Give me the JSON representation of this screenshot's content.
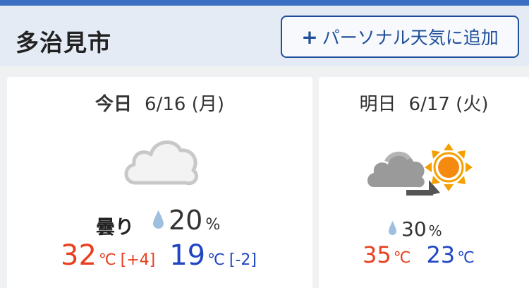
{
  "header": {
    "city": "多治見市",
    "add_button": {
      "plus": "+",
      "label": "パーソナル天気に追加"
    }
  },
  "today": {
    "day_label": "今日",
    "date": "6/16 (月)",
    "condition": "曇り",
    "icon": "cloudy-icon",
    "rain": {
      "value": "20",
      "unit": "%"
    },
    "high": {
      "value": "32",
      "unit": "℃",
      "diff": "[+4]"
    },
    "low": {
      "value": "19",
      "unit": "℃",
      "diff": "[-2]"
    }
  },
  "tomorrow": {
    "day_label": "明日",
    "date": "6/17 (火)",
    "icon": "cloudy-then-sunny-icon",
    "rain": {
      "value": "30",
      "unit": "%"
    },
    "high": {
      "value": "35",
      "unit": "℃"
    },
    "low": {
      "value": "23",
      "unit": "℃"
    }
  },
  "colors": {
    "accent": "#1f4f9a",
    "high": "#e8401f",
    "low": "#2046c2",
    "sun": "#f5a000"
  }
}
